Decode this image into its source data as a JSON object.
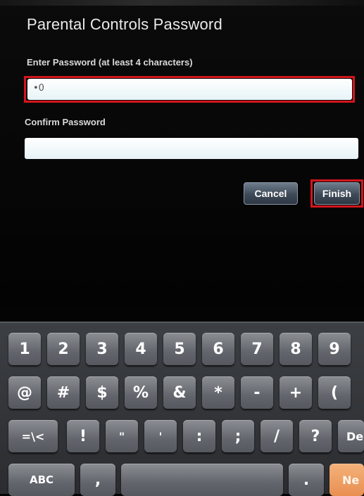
{
  "dialog": {
    "title": "Parental Controls Password",
    "password_label": "Enter Password (at least 4 characters)",
    "password_value": "•0",
    "confirm_label": "Confirm Password",
    "confirm_value": "",
    "cancel_label": "Cancel",
    "finish_label": "Finish"
  },
  "keyboard": {
    "row1": [
      "1",
      "2",
      "3",
      "4",
      "5",
      "6",
      "7",
      "8",
      "9"
    ],
    "row2": [
      "@",
      "#",
      "$",
      "%",
      "&",
      "*",
      "-",
      "+",
      "("
    ],
    "row3": [
      "=\\<",
      "!",
      "\"",
      "'",
      ":",
      ";",
      "/",
      "?",
      "De"
    ],
    "row4": [
      "ABC",
      ",",
      "",
      ".",
      "Ne"
    ]
  },
  "colors": {
    "highlight": "#d3151c",
    "field_bg": "#eef7fa",
    "button_bg": "#4a5666"
  }
}
